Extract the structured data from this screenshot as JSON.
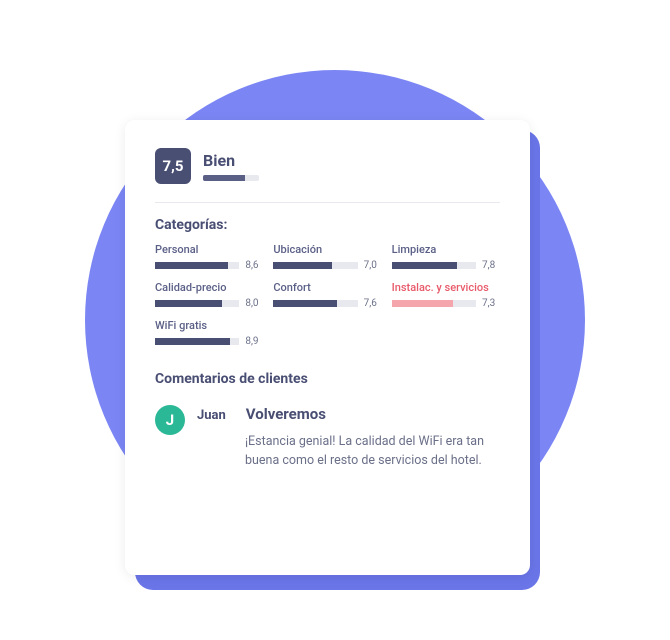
{
  "overall": {
    "score": "7,5",
    "label": "Bien",
    "bar_pct": 75
  },
  "categories_title": "Categorías:",
  "categories": [
    {
      "label": "Personal",
      "value": "8,6",
      "pct": 86,
      "danger": false
    },
    {
      "label": "Ubicación",
      "value": "7,0",
      "pct": 70,
      "danger": false
    },
    {
      "label": "Limpieza",
      "value": "7,8",
      "pct": 78,
      "danger": false
    },
    {
      "label": "Calidad-precio",
      "value": "8,0",
      "pct": 80,
      "danger": false
    },
    {
      "label": "Confort",
      "value": "7,6",
      "pct": 76,
      "danger": false
    },
    {
      "label": "Instalac. y servicios",
      "value": "7,3",
      "pct": 73,
      "danger": true
    },
    {
      "label": "WiFi gratis",
      "value": "8,9",
      "pct": 89,
      "danger": false
    }
  ],
  "reviews_title": "Comentarios de clientes",
  "review": {
    "avatar_initial": "J",
    "author": "Juan",
    "title": "Volveremos",
    "text": "¡Estancia genial! La calidad del WiFi era tan buena como el resto de servicios del hotel."
  },
  "chart_data": {
    "type": "bar",
    "title": "Categorías",
    "categories": [
      "Personal",
      "Ubicación",
      "Limpieza",
      "Calidad-precio",
      "Confort",
      "Instalac. y servicios",
      "WiFi gratis"
    ],
    "values": [
      8.6,
      7.0,
      7.8,
      8.0,
      7.6,
      7.3,
      8.9
    ],
    "ylim": [
      0,
      10
    ],
    "xlabel": "",
    "ylabel": ""
  }
}
